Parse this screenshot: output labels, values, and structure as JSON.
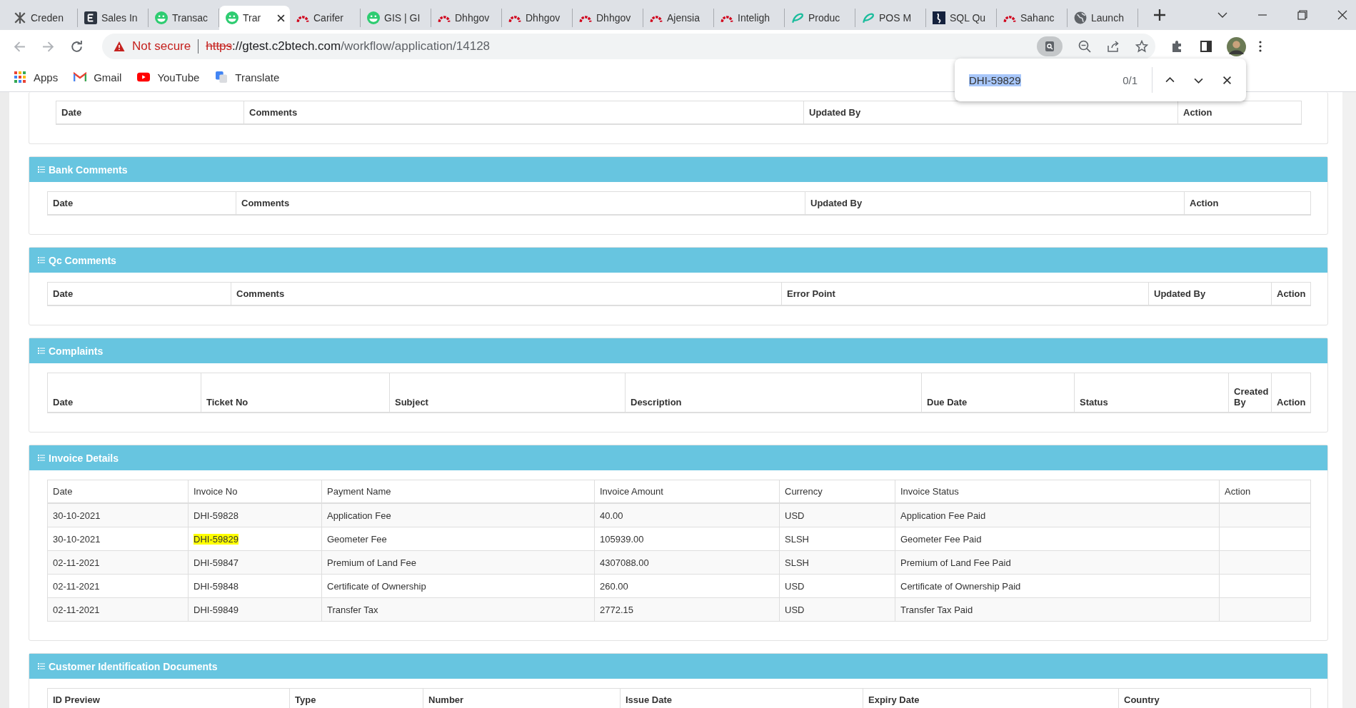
{
  "tabs": [
    {
      "title": "Creden",
      "kind": "x-logo",
      "selected": false
    },
    {
      "title": "Sales In",
      "kind": "letter-e",
      "selected": false
    },
    {
      "title": "Transac",
      "kind": "green-face",
      "selected": false
    },
    {
      "title": "Trar",
      "kind": "green-face",
      "selected": true
    },
    {
      "title": "Carifer",
      "kind": "red-arc",
      "selected": false
    },
    {
      "title": "GIS | GI",
      "kind": "green-face",
      "selected": false
    },
    {
      "title": "Dhhgov",
      "kind": "red-arc",
      "selected": false
    },
    {
      "title": "Dhhgov",
      "kind": "red-arc",
      "selected": false
    },
    {
      "title": "Dhhgov",
      "kind": "red-arc",
      "selected": false
    },
    {
      "title": "Ajensia",
      "kind": "red-arc",
      "selected": false
    },
    {
      "title": "Inteligh",
      "kind": "red-arc",
      "selected": false
    },
    {
      "title": "Produc",
      "kind": "teal-a",
      "selected": false
    },
    {
      "title": "POS M",
      "kind": "teal-a",
      "selected": false
    },
    {
      "title": "SQL Qu",
      "kind": "sql",
      "selected": false
    },
    {
      "title": "Sahanc",
      "kind": "red-arc",
      "selected": false
    },
    {
      "title": "Launch",
      "kind": "globe",
      "selected": false
    }
  ],
  "address_bar": {
    "security": "Not secure",
    "scheme": "https",
    "host": "://gtest.c2btech.com",
    "path": "/workflow/application/14128"
  },
  "bookmarks": [
    {
      "label": "Apps",
      "kind": "apps"
    },
    {
      "label": "Gmail",
      "kind": "gmail"
    },
    {
      "label": "YouTube",
      "kind": "youtube"
    },
    {
      "label": "Translate",
      "kind": "translate"
    }
  ],
  "find_bar": {
    "query": "DHI-59829",
    "count": "0/1"
  },
  "sections": [
    {
      "columns": [
        "Date",
        "Comments",
        "Updated By",
        "Action"
      ]
    },
    {
      "title": "Bank Comments",
      "columns": [
        "Date",
        "Comments",
        "Updated By",
        "Action"
      ]
    },
    {
      "title": "Qc Comments",
      "columns": [
        "Date",
        "Comments",
        "Error Point",
        "Updated By",
        "Action"
      ]
    },
    {
      "title": "Complaints",
      "columns": [
        "Date",
        "Ticket No",
        "Subject",
        "Description",
        "Due Date",
        "Status",
        "Created By",
        "Action"
      ]
    },
    {
      "title": "Invoice Details",
      "columns": [
        "Date",
        "Invoice No",
        "Payment Name",
        "Invoice Amount",
        "Currency",
        "Invoice Status",
        "Action"
      ],
      "rows": [
        {
          "cells": [
            {
              "text": "30-10-2021",
              "highlighted": false
            },
            {
              "text": "DHI-59828",
              "highlighted": false
            },
            {
              "text": "Application Fee",
              "highlighted": false
            },
            {
              "text": "40.00",
              "highlighted": false
            },
            {
              "text": "USD",
              "highlighted": false
            },
            {
              "text": "Application Fee Paid",
              "highlighted": false
            }
          ]
        },
        {
          "cells": [
            {
              "text": "30-10-2021",
              "highlighted": false
            },
            {
              "text": "DHI-59829",
              "highlighted": true
            },
            {
              "text": "Geometer Fee",
              "highlighted": false
            },
            {
              "text": "105939.00",
              "highlighted": false
            },
            {
              "text": "SLSH",
              "highlighted": false
            },
            {
              "text": "Geometer Fee Paid",
              "highlighted": false
            }
          ]
        },
        {
          "cells": [
            {
              "text": "02-11-2021",
              "highlighted": false
            },
            {
              "text": "DHI-59847",
              "highlighted": false
            },
            {
              "text": "Premium of Land Fee",
              "highlighted": false
            },
            {
              "text": "4307088.00",
              "highlighted": false
            },
            {
              "text": "SLSH",
              "highlighted": false
            },
            {
              "text": "Premium of Land Fee Paid",
              "highlighted": false
            }
          ]
        },
        {
          "cells": [
            {
              "text": "02-11-2021",
              "highlighted": false
            },
            {
              "text": "DHI-59848",
              "highlighted": false
            },
            {
              "text": "Certificate of Ownership",
              "highlighted": false
            },
            {
              "text": "260.00",
              "highlighted": false
            },
            {
              "text": "USD",
              "highlighted": false
            },
            {
              "text": "Certificate of Ownership Paid",
              "highlighted": false
            }
          ]
        },
        {
          "cells": [
            {
              "text": "02-11-2021",
              "highlighted": false
            },
            {
              "text": "DHI-59849",
              "highlighted": false
            },
            {
              "text": "Transfer Tax",
              "highlighted": false
            },
            {
              "text": "2772.15",
              "highlighted": false
            },
            {
              "text": "USD",
              "highlighted": false
            },
            {
              "text": "Transfer Tax Paid",
              "highlighted": false
            }
          ]
        }
      ]
    },
    {
      "title": "Customer Identification Documents",
      "columns": [
        "ID Preview",
        "Type",
        "Number",
        "Issue Date",
        "Expiry Date",
        "Country"
      ]
    }
  ]
}
